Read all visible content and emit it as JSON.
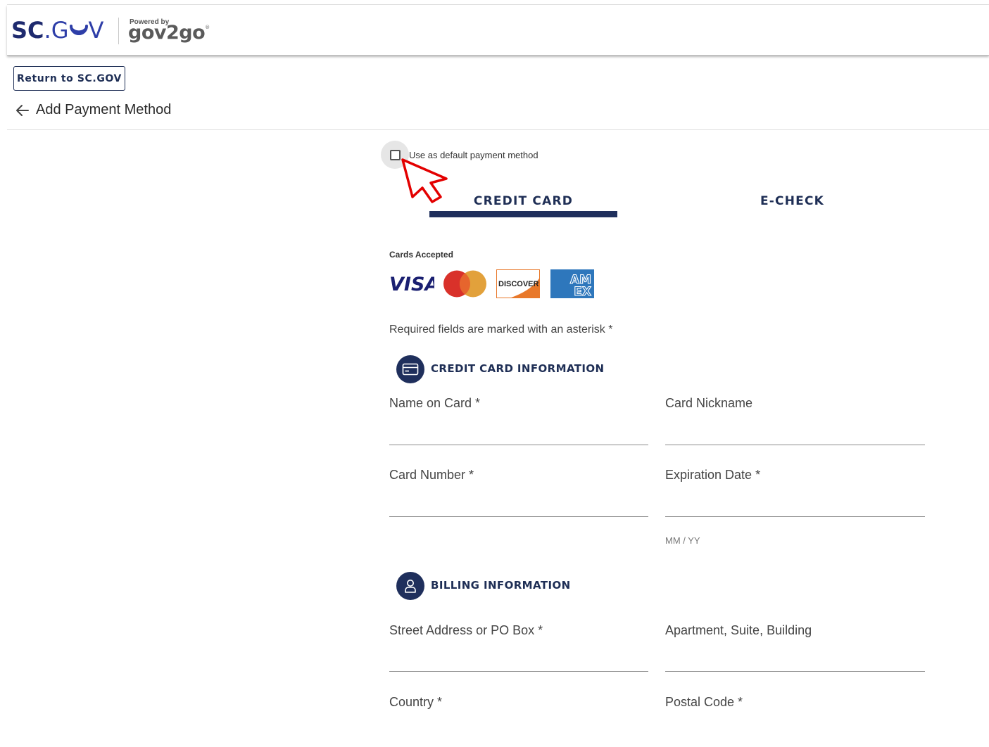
{
  "header": {
    "logo_sc": "SC",
    "logo_dot": ".",
    "logo_g": "G",
    "logo_v": "V",
    "powered_by": "Powered by",
    "gov2go": "gov2go",
    "gov2go_mark": "®"
  },
  "return_button": "Return to SC.GOV",
  "page_title": "Add Payment Method",
  "default_checkbox": {
    "label": "Use as default payment method",
    "checked": false
  },
  "tabs": [
    {
      "label": "CREDIT CARD",
      "active": true
    },
    {
      "label": "E-CHECK",
      "active": false
    }
  ],
  "cards_accepted": {
    "label": "Cards Accepted",
    "visa": "VISA",
    "discover": "DISCOVER",
    "amex_top": "AM",
    "amex_bottom": "EX"
  },
  "required_note": "Required fields are marked with an asterisk *",
  "credit_card_section": {
    "title": "CREDIT CARD INFORMATION",
    "fields": {
      "name_on_card": {
        "label": "Name on Card *",
        "value": ""
      },
      "card_nickname": {
        "label": "Card Nickname",
        "value": ""
      },
      "card_number": {
        "label": "Card Number *",
        "value": ""
      },
      "expiration_date": {
        "label": "Expiration Date *",
        "value": "",
        "hint": "MM / YY"
      }
    }
  },
  "billing_section": {
    "title": "BILLING INFORMATION",
    "fields": {
      "street": {
        "label": "Street Address or PO Box *",
        "value": ""
      },
      "apartment": {
        "label": "Apartment, Suite, Building",
        "value": ""
      },
      "country": {
        "label": "Country *",
        "value": ""
      },
      "postal_code": {
        "label": "Postal Code *",
        "value": ""
      }
    }
  },
  "colors": {
    "navy": "#1f2f5c",
    "sc_blue": "#2e3ea8",
    "visa_blue": "#1a1f71",
    "mc_red": "#eb001b",
    "mc_orange": "#f79e1b",
    "discover_orange": "#e8782a",
    "amex_blue": "#2e77bc",
    "cursor_red": "#e30000"
  }
}
